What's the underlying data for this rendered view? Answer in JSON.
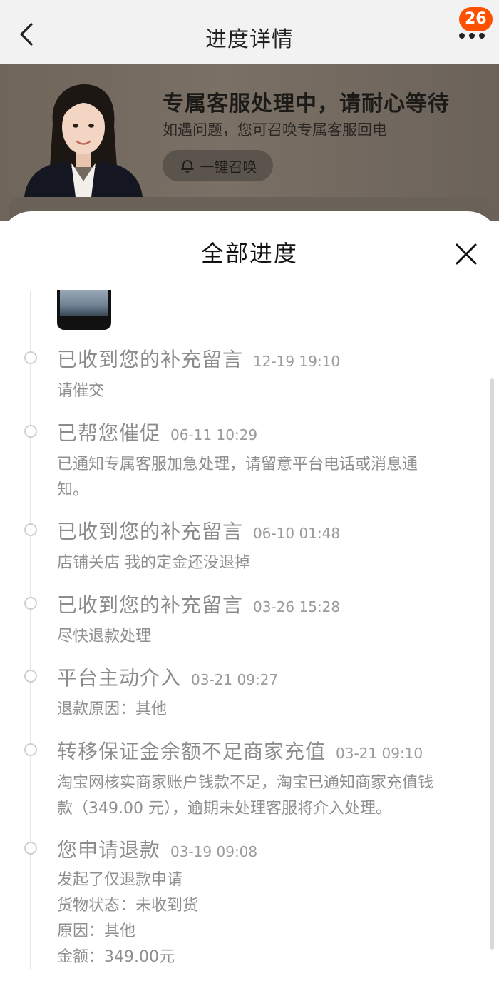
{
  "nav": {
    "title": "进度详情",
    "badge_count": "26"
  },
  "banner": {
    "title": "专属客服处理中，请耐心等待",
    "subtitle": "如遇问题，您可召唤专属客服回电",
    "call_button": "一键召唤"
  },
  "sheet": {
    "title": "全部进度",
    "entries": [
      {
        "title": "已收到您的补充留言",
        "time": "12-19 19:10",
        "desc": "请催交"
      },
      {
        "title": "已帮您催促",
        "time": "06-11 10:29",
        "desc": "已通知专属客服加急处理，请留意平台电话或消息通\n知。"
      },
      {
        "title": "已收到您的补充留言",
        "time": "06-10 01:48",
        "desc": "店铺关店 我的定金还没退掉"
      },
      {
        "title": "已收到您的补充留言",
        "time": "03-26 15:28",
        "desc": "尽快退款处理"
      },
      {
        "title": "平台主动介入",
        "time": "03-21 09:27",
        "desc": "退款原因：其他"
      },
      {
        "title": "转移保证金余额不足商家充值",
        "time": "03-21 09:10",
        "desc": "淘宝网核实商家账户钱款不足，淘宝已通知商家充值钱\n款（349.00 元），逾期未处理客服将介入处理。"
      },
      {
        "title": "您申请退款",
        "time": "03-19 09:08",
        "desc": "发起了仅退款申请\n货物状态：未收到货\n原因：其他\n金额：349.00元"
      }
    ]
  }
}
